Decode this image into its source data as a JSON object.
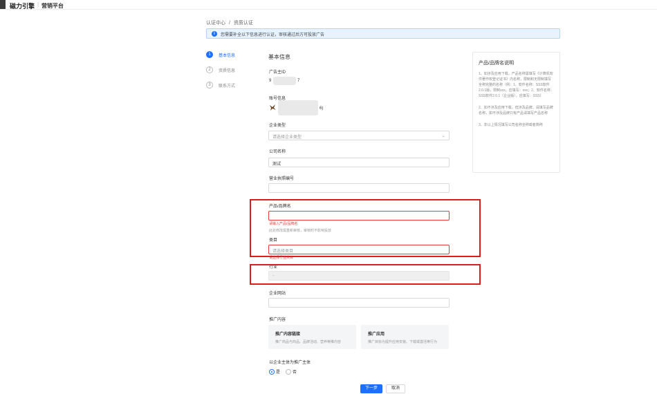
{
  "header": {
    "brand": "磁力引擎",
    "separator": "|",
    "subtitle": "营销平台"
  },
  "breadcrumb": {
    "parent": "认证中心",
    "separator": "/",
    "current": "资质认证"
  },
  "notice": {
    "icon": "info-icon",
    "text": "您需要补全以下信息进行认证，审核通过后方可投放广告"
  },
  "steps": [
    {
      "num": "1",
      "label": "基本信息",
      "active": true
    },
    {
      "num": "2",
      "label": "资质信息",
      "active": false
    },
    {
      "num": "3",
      "label": "联系方式",
      "active": false
    }
  ],
  "form": {
    "section_title": "基本信息",
    "account_id_label": "广告主ID",
    "account_id_prefix": "9",
    "account_id_suffix": "7",
    "account_info_label": "账号信息",
    "account_info_suffix": "6)",
    "company_type_label": "企业类型",
    "company_type_placeholder": "请选择企业类型",
    "company_name_label": "公司名称",
    "company_name_value": "测试",
    "license_label": "营业执照编号",
    "license_value": "",
    "product_label": "产品/品牌名",
    "product_value": "",
    "product_error": "请输入产品/品牌名",
    "product_hint": "此处修改需重新审核，审核时不影响投放",
    "category_label": "类目",
    "category_placeholder": "请选择类目",
    "category_error": "请选择行业类目",
    "industry_label": "行业",
    "industry_value": "-",
    "website_label": "企业网站",
    "website_value": "",
    "promo_label": "推广内容",
    "promo_cards": [
      {
        "title": "推广内容链接",
        "desc": "推广商品与商品、品牌活动、营养等推内容"
      },
      {
        "title": "推广应用",
        "desc": "推广目标为提升应用安装、下载或激活等行为"
      }
    ],
    "subject_label": "以企业主体为推广主体",
    "radio_yes": "是",
    "radio_no": "否",
    "next_button": "下一步",
    "cancel_button": "取消"
  },
  "aside": {
    "title": "产品/品牌名说明",
    "items": [
      "1、如涉及应用下载，产品名称需填写《计算机软件著作权登记证书》内名称，限制和无限制填写全称完整的名称（例：1、软件名称：SSS软件2.0.1版，限制xxx，应填写：xxx；2、软件名称：SSS软件2.0.1（企业版），应填写：SSS）",
      "2、如不涉及应用下载，但涉及品牌，请填写品牌名称，如不涉及品牌只有产品请填写产品名称",
      "3、非以上情况填写公司名称全称或者简称"
    ]
  },
  "colors": {
    "primary": "#1e6fff",
    "error": "#e23c3c",
    "highlight": "#d81e1e"
  }
}
